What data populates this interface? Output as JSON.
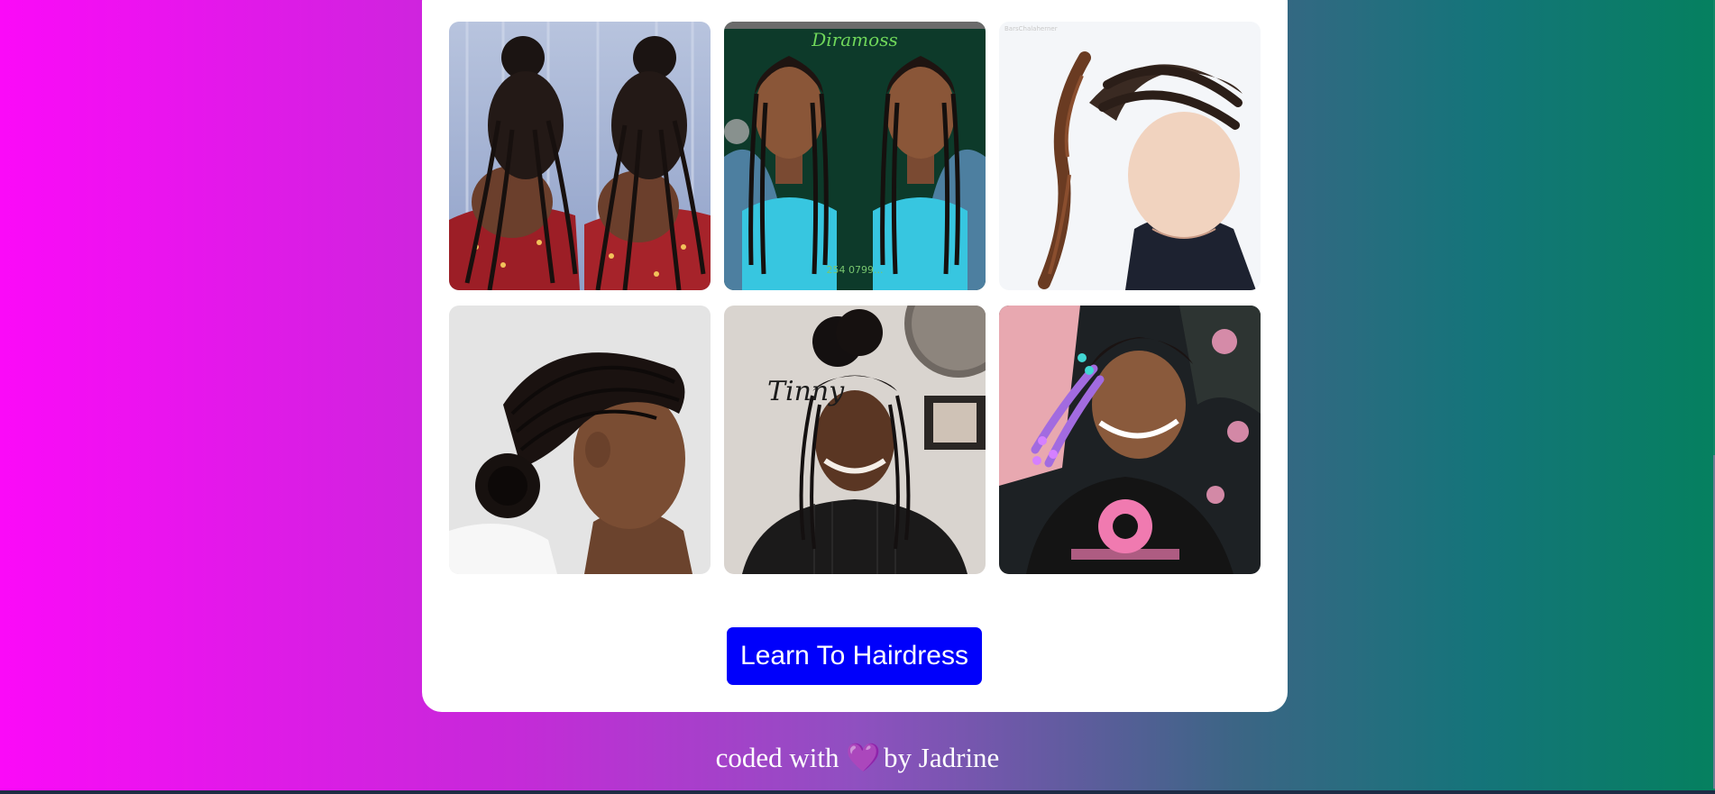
{
  "gallery": {
    "photos": [
      {
        "subject": "stitch-braids-back-view"
      },
      {
        "subject": "lemonade-braids-front-view",
        "brand": "Diramoss",
        "phone": "254 0799..."
      },
      {
        "subject": "dutch-braids-side-view",
        "credit": "BarsChalaherner"
      },
      {
        "subject": "cornrow-bun-profile"
      },
      {
        "subject": "boho-half-up-knotless",
        "signature": "Tinny"
      },
      {
        "subject": "kids-braids-with-beads"
      }
    ]
  },
  "cta": {
    "label": "Learn To Hairdress",
    "color": "#0000fb"
  },
  "footer": {
    "prefix": "coded with",
    "heart": "💜",
    "suffix": "by Jadrine"
  },
  "theme": {
    "gradient_left": "#fb0af8",
    "gradient_right": "#05805f",
    "card": "#ffffff"
  }
}
